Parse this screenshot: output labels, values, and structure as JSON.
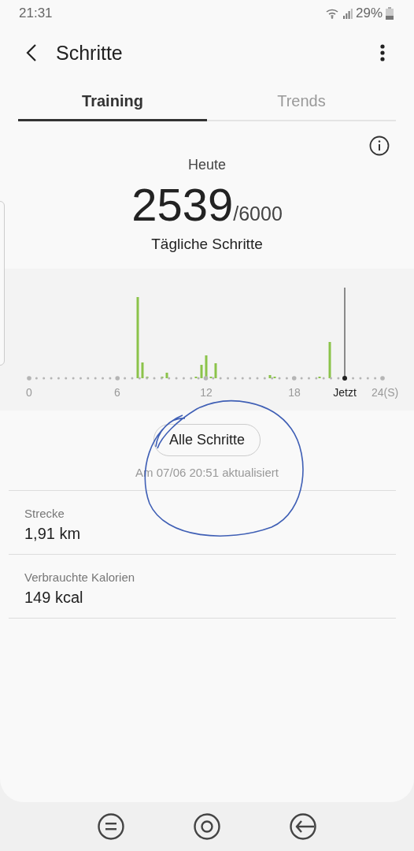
{
  "status_bar": {
    "time": "21:31",
    "battery": "29%"
  },
  "header": {
    "title": "Schritte"
  },
  "tabs": [
    {
      "label": "Training",
      "selected": true
    },
    {
      "label": "Trends",
      "selected": false
    }
  ],
  "summary": {
    "period": "Heute",
    "steps": "2539",
    "goal": "/6000",
    "caption": "Tägliche Schritte"
  },
  "chart": {
    "x_labels": [
      {
        "label": "0",
        "kind": "tick"
      },
      {
        "label": "6",
        "kind": "tick"
      },
      {
        "label": "12",
        "kind": "tick"
      },
      {
        "label": "18",
        "kind": "tick"
      },
      {
        "label": "Jetzt",
        "kind": "now"
      },
      {
        "label": "24(S)",
        "kind": "tick"
      }
    ]
  },
  "all_steps_button": "Alle Schritte",
  "updated": "Am 07/06 20:51 aktualisiert",
  "stats": [
    {
      "label": "Strecke",
      "value": "1,91 km"
    },
    {
      "label": "Verbrauchte Kalorien",
      "value": "149 kcal"
    }
  ]
}
